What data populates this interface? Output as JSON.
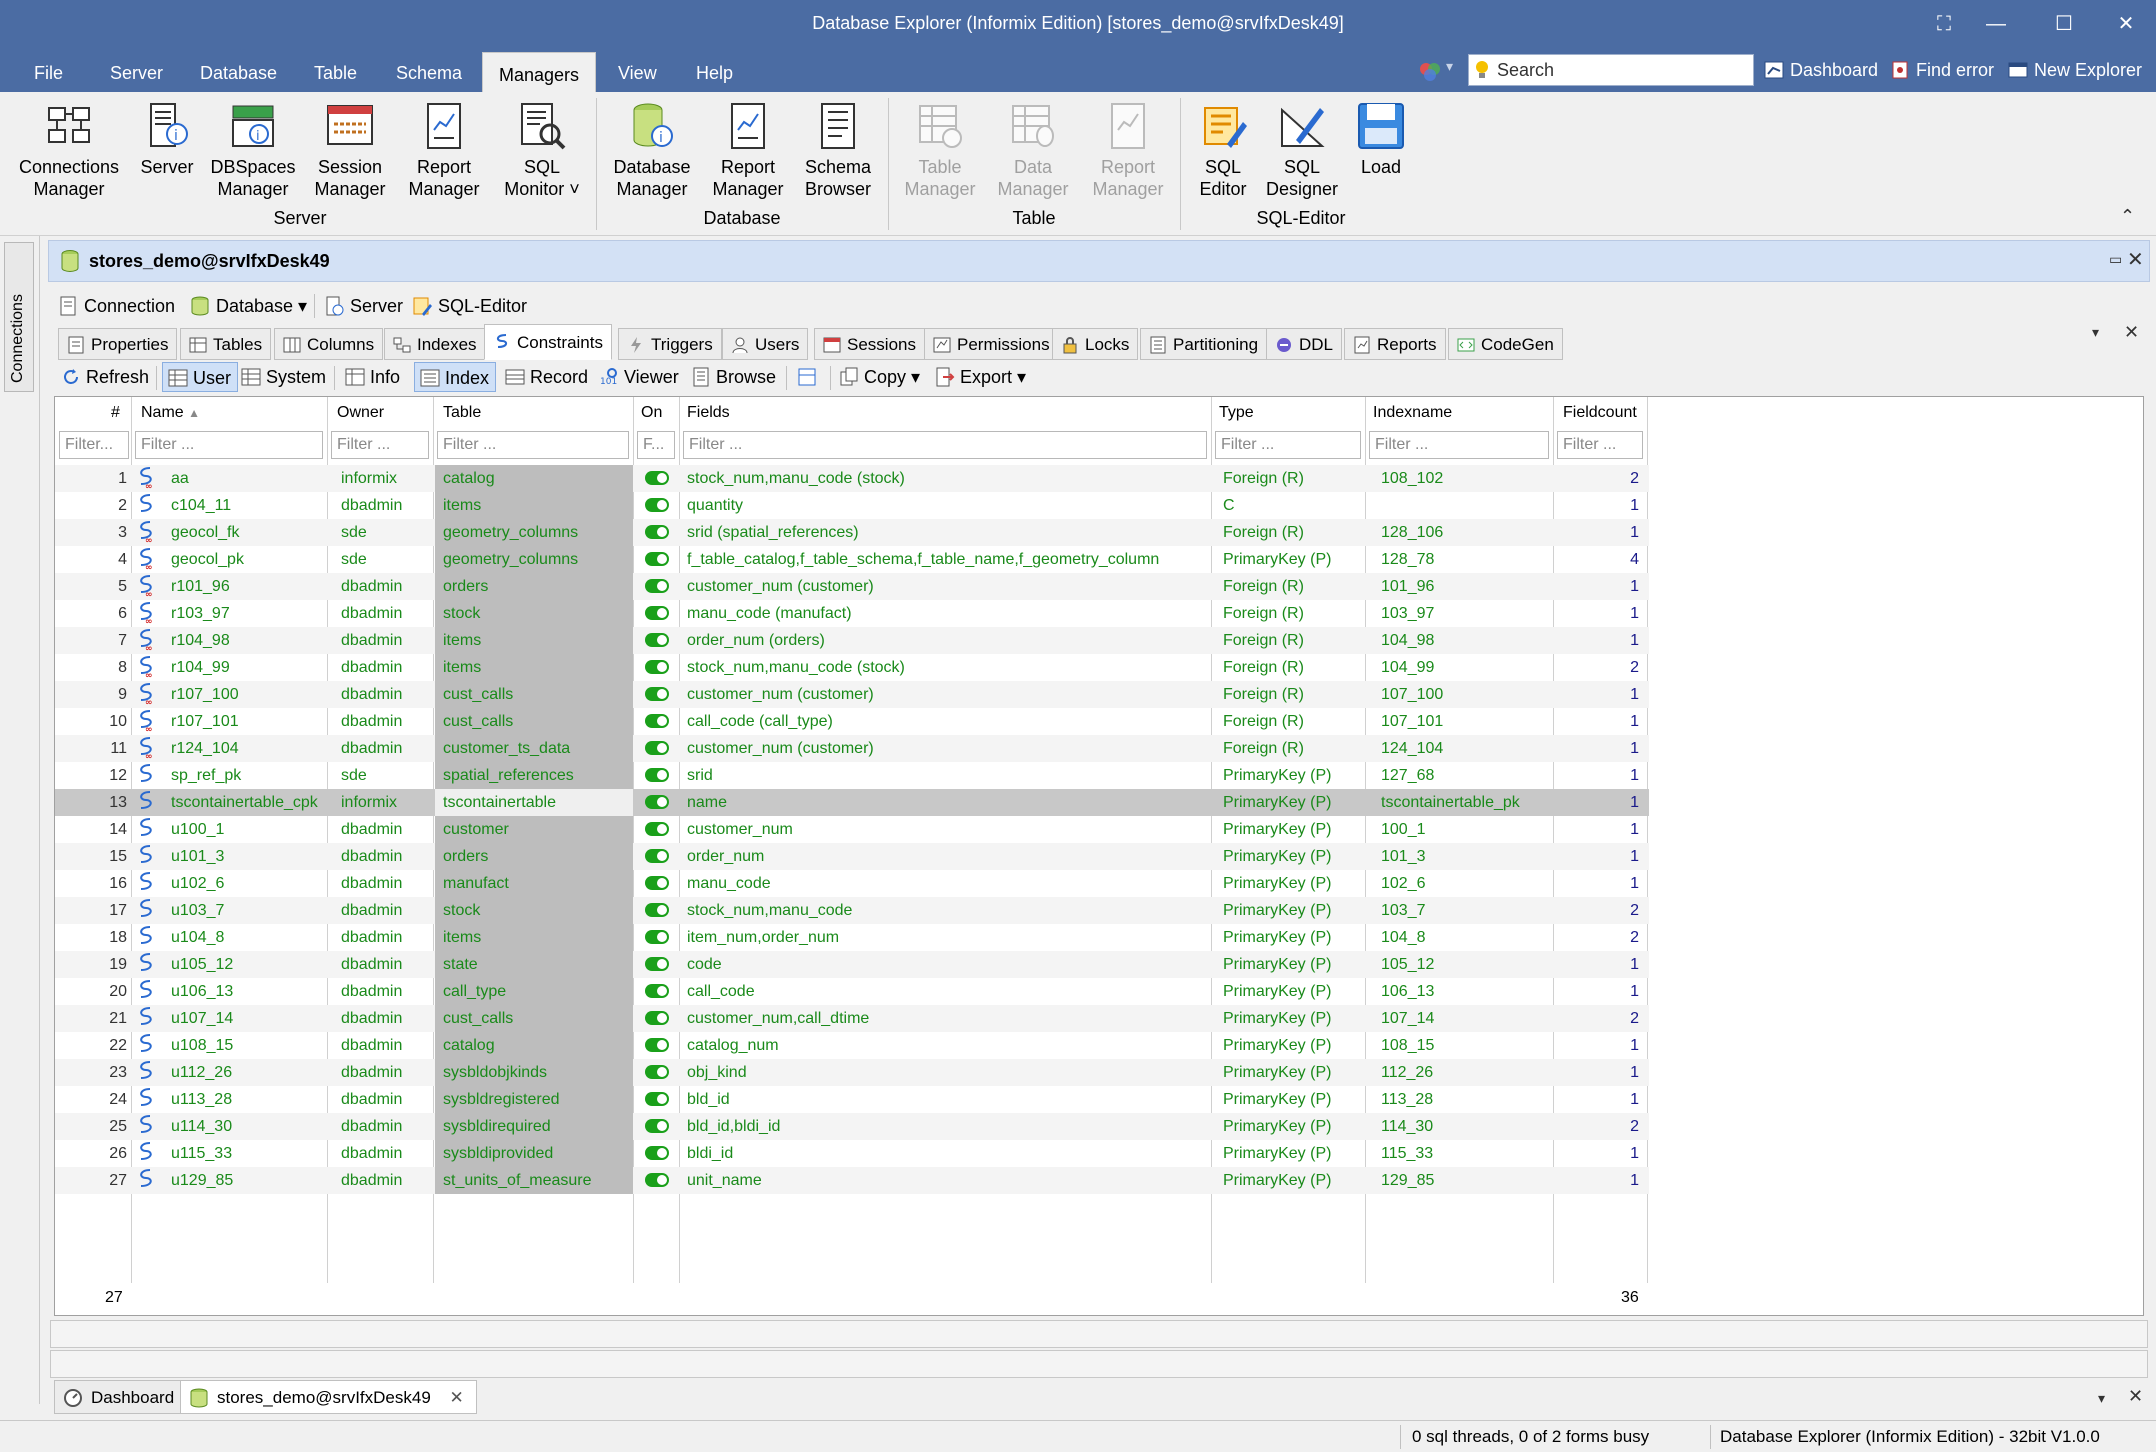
{
  "window": {
    "title": "Database Explorer (Informix Edition) [stores_demo@srvIfxDesk49]"
  },
  "menu": [
    "File",
    "Server",
    "Database",
    "Table",
    "Schema",
    "Managers",
    "View",
    "Help"
  ],
  "search": {
    "placeholder": "Search"
  },
  "quicklinks": {
    "dashboard": "Dashboard",
    "find_error": "Find error",
    "new_explorer": "New Explorer"
  },
  "ribbon": {
    "server_group": "Server",
    "database_group": "Database",
    "table_group": "Table",
    "sqleditor_group": "SQL-Editor",
    "buttons": {
      "connections_manager": "Connections\nManager",
      "server": "Server",
      "dbspaces_manager": "DBSpaces\nManager",
      "session_manager": "Session\nManager",
      "report_manager": "Report\nManager",
      "sql_monitor": "SQL\nMonitor ˅",
      "database_manager": "Database\nManager",
      "db_report_manager": "Report\nManager",
      "schema_browser": "Schema\nBrowser",
      "table_manager": "Table\nManager",
      "data_manager": "Data\nManager",
      "tbl_report_manager": "Report\nManager",
      "sql_editor": "SQL\nEditor",
      "sql_designer": "SQL\nDesigner",
      "load": "Load"
    }
  },
  "side": {
    "connections": "Connections"
  },
  "document": {
    "title": "stores_demo@srvIfxDesk49"
  },
  "toolbar1": {
    "connection": "Connection",
    "database": "Database ▾",
    "server": "Server",
    "sql_editor": "SQL-Editor"
  },
  "tabs": [
    "Properties",
    "Tables",
    "Columns",
    "Indexes",
    "Constraints",
    "Triggers",
    "Users",
    "Sessions",
    "Permissions",
    "Locks",
    "Partitioning",
    "DDL",
    "Reports",
    "CodeGen"
  ],
  "toolbar2": {
    "refresh": "Refresh",
    "user": "User",
    "system": "System",
    "info": "Info",
    "index": "Index",
    "record": "Record",
    "viewer": "Viewer",
    "browse": "Browse",
    "copy": "Copy ▾",
    "export": "Export ▾"
  },
  "grid": {
    "headers": {
      "num": "#",
      "name": "Name",
      "owner": "Owner",
      "table": "Table",
      "on": "On",
      "fields": "Fields",
      "type": "Type",
      "indexname": "Indexname",
      "fieldcount": "Fieldcount"
    },
    "filter_placeholder": "Filter ...",
    "filter_short": "Filter...",
    "filter_on": "F...",
    "rows": [
      {
        "n": "1",
        "name": "aa",
        "owner": "informix",
        "table": "catalog",
        "fields": "stock_num,manu_code (stock)",
        "type": "Foreign (R)",
        "idx": "108_102",
        "fc": "2",
        "fk": true
      },
      {
        "n": "2",
        "name": "c104_11",
        "owner": "dbadmin",
        "table": "items",
        "fields": "quantity",
        "type": "C",
        "idx": "",
        "fc": "1",
        "fk": false
      },
      {
        "n": "3",
        "name": "geocol_fk",
        "owner": "sde",
        "table": "geometry_columns",
        "fields": "srid (spatial_references)",
        "type": "Foreign (R)",
        "idx": "128_106",
        "fc": "1",
        "fk": true
      },
      {
        "n": "4",
        "name": "geocol_pk",
        "owner": "sde",
        "table": "geometry_columns",
        "fields": "f_table_catalog,f_table_schema,f_table_name,f_geometry_column",
        "type": "PrimaryKey (P)",
        "idx": "128_78",
        "fc": "4",
        "fk": true
      },
      {
        "n": "5",
        "name": "r101_96",
        "owner": "dbadmin",
        "table": "orders",
        "fields": "customer_num (customer)",
        "type": "Foreign (R)",
        "idx": "101_96",
        "fc": "1",
        "fk": true
      },
      {
        "n": "6",
        "name": "r103_97",
        "owner": "dbadmin",
        "table": "stock",
        "fields": "manu_code (manufact)",
        "type": "Foreign (R)",
        "idx": "103_97",
        "fc": "1",
        "fk": true
      },
      {
        "n": "7",
        "name": "r104_98",
        "owner": "dbadmin",
        "table": "items",
        "fields": "order_num (orders)",
        "type": "Foreign (R)",
        "idx": "104_98",
        "fc": "1",
        "fk": true
      },
      {
        "n": "8",
        "name": "r104_99",
        "owner": "dbadmin",
        "table": "items",
        "fields": "stock_num,manu_code (stock)",
        "type": "Foreign (R)",
        "idx": "104_99",
        "fc": "2",
        "fk": true
      },
      {
        "n": "9",
        "name": "r107_100",
        "owner": "dbadmin",
        "table": "cust_calls",
        "fields": "customer_num (customer)",
        "type": "Foreign (R)",
        "idx": "107_100",
        "fc": "1",
        "fk": true
      },
      {
        "n": "10",
        "name": "r107_101",
        "owner": "dbadmin",
        "table": "cust_calls",
        "fields": "call_code (call_type)",
        "type": "Foreign (R)",
        "idx": "107_101",
        "fc": "1",
        "fk": true
      },
      {
        "n": "11",
        "name": "r124_104",
        "owner": "dbadmin",
        "table": "customer_ts_data",
        "fields": "customer_num (customer)",
        "type": "Foreign (R)",
        "idx": "124_104",
        "fc": "1",
        "fk": true
      },
      {
        "n": "12",
        "name": "sp_ref_pk",
        "owner": "sde",
        "table": "spatial_references",
        "fields": "srid",
        "type": "PrimaryKey (P)",
        "idx": "127_68",
        "fc": "1",
        "fk": false
      },
      {
        "n": "13",
        "name": "tscontainertable_cpk",
        "owner": "informix",
        "table": "tscontainertable",
        "fields": "name",
        "type": "PrimaryKey (P)",
        "idx": "tscontainertable_pk",
        "fc": "1",
        "fk": false,
        "sel": true
      },
      {
        "n": "14",
        "name": "u100_1",
        "owner": "dbadmin",
        "table": "customer",
        "fields": "customer_num",
        "type": "PrimaryKey (P)",
        "idx": "100_1",
        "fc": "1",
        "fk": false
      },
      {
        "n": "15",
        "name": "u101_3",
        "owner": "dbadmin",
        "table": "orders",
        "fields": "order_num",
        "type": "PrimaryKey (P)",
        "idx": "101_3",
        "fc": "1",
        "fk": false
      },
      {
        "n": "16",
        "name": "u102_6",
        "owner": "dbadmin",
        "table": "manufact",
        "fields": "manu_code",
        "type": "PrimaryKey (P)",
        "idx": "102_6",
        "fc": "1",
        "fk": false
      },
      {
        "n": "17",
        "name": "u103_7",
        "owner": "dbadmin",
        "table": "stock",
        "fields": "stock_num,manu_code",
        "type": "PrimaryKey (P)",
        "idx": "103_7",
        "fc": "2",
        "fk": false
      },
      {
        "n": "18",
        "name": "u104_8",
        "owner": "dbadmin",
        "table": "items",
        "fields": "item_num,order_num",
        "type": "PrimaryKey (P)",
        "idx": "104_8",
        "fc": "2",
        "fk": false
      },
      {
        "n": "19",
        "name": "u105_12",
        "owner": "dbadmin",
        "table": "state",
        "fields": "code",
        "type": "PrimaryKey (P)",
        "idx": "105_12",
        "fc": "1",
        "fk": false
      },
      {
        "n": "20",
        "name": "u106_13",
        "owner": "dbadmin",
        "table": "call_type",
        "fields": "call_code",
        "type": "PrimaryKey (P)",
        "idx": "106_13",
        "fc": "1",
        "fk": false
      },
      {
        "n": "21",
        "name": "u107_14",
        "owner": "dbadmin",
        "table": "cust_calls",
        "fields": "customer_num,call_dtime",
        "type": "PrimaryKey (P)",
        "idx": "107_14",
        "fc": "2",
        "fk": false
      },
      {
        "n": "22",
        "name": "u108_15",
        "owner": "dbadmin",
        "table": "catalog",
        "fields": "catalog_num",
        "type": "PrimaryKey (P)",
        "idx": "108_15",
        "fc": "1",
        "fk": false
      },
      {
        "n": "23",
        "name": "u112_26",
        "owner": "dbadmin",
        "table": "sysbldobjkinds",
        "fields": "obj_kind",
        "type": "PrimaryKey (P)",
        "idx": "112_26",
        "fc": "1",
        "fk": false
      },
      {
        "n": "24",
        "name": "u113_28",
        "owner": "dbadmin",
        "table": "sysbldregistered",
        "fields": "bld_id",
        "type": "PrimaryKey (P)",
        "idx": "113_28",
        "fc": "1",
        "fk": false
      },
      {
        "n": "25",
        "name": "u114_30",
        "owner": "dbadmin",
        "table": "sysbldirequired",
        "fields": "bld_id,bldi_id",
        "type": "PrimaryKey (P)",
        "idx": "114_30",
        "fc": "2",
        "fk": false
      },
      {
        "n": "26",
        "name": "u115_33",
        "owner": "dbadmin",
        "table": "sysbldiprovided",
        "fields": "bldi_id",
        "type": "PrimaryKey (P)",
        "idx": "115_33",
        "fc": "1",
        "fk": false
      },
      {
        "n": "27",
        "name": "u129_85",
        "owner": "dbadmin",
        "table": "st_units_of_measure",
        "fields": "unit_name",
        "type": "PrimaryKey (P)",
        "idx": "129_85",
        "fc": "1",
        "fk": false
      }
    ],
    "footer": {
      "count": "27",
      "fieldcount_sum": "36"
    }
  },
  "bottom_tabs": {
    "dashboard": "Dashboard",
    "doc": "stores_demo@srvIfxDesk49"
  },
  "status": {
    "threads": "0 sql threads, 0 of 2 forms busy",
    "version": "Database Explorer (Informix Edition) - 32bit V1.0.0"
  },
  "colors": {
    "title_bar": "#4b6ca3",
    "grid_text": "#1a8a1a",
    "count_text": "#1a1a8a",
    "header_doc": "#d3e1f5"
  }
}
